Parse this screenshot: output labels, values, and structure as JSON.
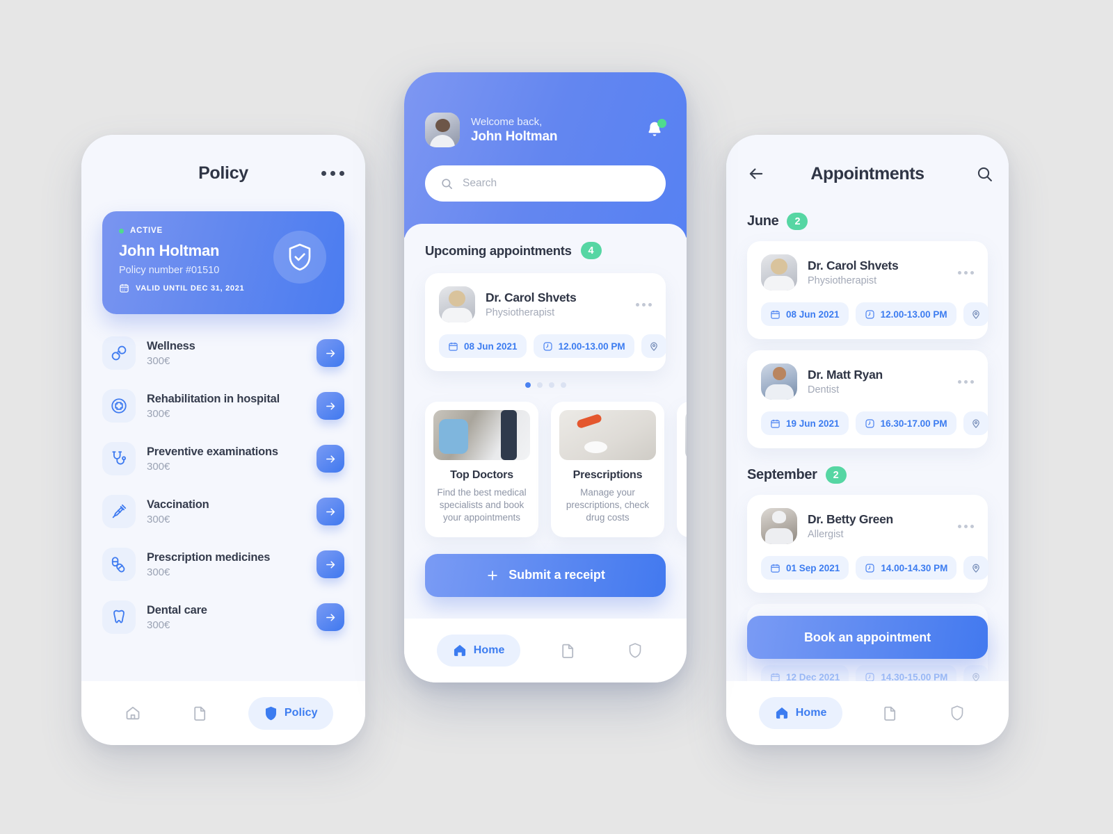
{
  "policy_screen": {
    "title": "Policy",
    "more_icon": "more-horizontal-icon",
    "card": {
      "status": "ACTIVE",
      "name": "John Holtman",
      "policy_number": "Policy number #01510",
      "valid_until": "VALID UNTIL DEC 31, 2021",
      "shield_icon": "shield-check-icon",
      "calendar_icon": "calendar-icon",
      "gradient_from": "#7a95f0",
      "gradient_to": "#4a7cf0",
      "status_dot_color": "#4fdc8e"
    },
    "benefits": [
      {
        "title": "Wellness",
        "price": "300€",
        "icon": "bandage-icon"
      },
      {
        "title": "Rehabilitation in hospital",
        "price": "300€",
        "icon": "hospital-cross-icon"
      },
      {
        "title": "Preventive examinations",
        "price": "300€",
        "icon": "stethoscope-icon"
      },
      {
        "title": "Vaccination",
        "price": "300€",
        "icon": "syringe-icon"
      },
      {
        "title": "Prescription medicines",
        "price": "300€",
        "icon": "pills-icon"
      },
      {
        "title": "Dental care",
        "price": "300€",
        "icon": "tooth-icon"
      }
    ],
    "nav": [
      {
        "label": "",
        "icon": "home-icon",
        "active": false
      },
      {
        "label": "",
        "icon": "document-icon",
        "active": false
      },
      {
        "label": "Policy",
        "icon": "shield-icon",
        "active": true
      }
    ]
  },
  "home_screen": {
    "greeting": "Welcome back,",
    "user_name": "John Holtman",
    "avatar_icon": "user-avatar",
    "bell_icon": "bell-icon",
    "bell_has_notification": true,
    "search": {
      "placeholder": "Search",
      "icon": "search-icon"
    },
    "section_title": "Upcoming appointments",
    "section_count": "4",
    "appointment": {
      "doctor": "Dr. Carol Shvets",
      "specialty": "Physiotherapist",
      "date": "08 Jun 2021",
      "time": "12.00-13.00 PM",
      "calendar_icon": "calendar-icon",
      "clock_icon": "clock-icon",
      "pin_icon": "map-pin-icon",
      "more_icon": "more-horizontal-icon"
    },
    "carousel_total": 4,
    "carousel_active": 0,
    "categories": [
      {
        "title": "Top Doctors",
        "description": "Find the best medical specialists and book your appointments",
        "image": "doctor-photo"
      },
      {
        "title": "Prescriptions",
        "description": "Manage your prescriptions, check drug costs",
        "image": "pills-photo"
      },
      {
        "title": "",
        "description": "",
        "image": "clipped-photo"
      }
    ],
    "submit_button": {
      "label": "Submit a receipt",
      "icon": "plus-icon"
    },
    "nav": [
      {
        "label": "Home",
        "icon": "home-icon",
        "active": true
      },
      {
        "label": "",
        "icon": "document-icon",
        "active": false
      },
      {
        "label": "",
        "icon": "shield-icon",
        "active": false
      }
    ]
  },
  "appointments_screen": {
    "title": "Appointments",
    "back_icon": "arrow-left-icon",
    "search_icon": "search-icon",
    "months": [
      {
        "name": "June",
        "count": "2",
        "appointments": [
          {
            "doctor": "Dr. Carol Shvets",
            "specialty": "Physiotherapist",
            "date": "08 Jun 2021",
            "time": "12.00-13.00 PM",
            "avatar": "carol-photo"
          },
          {
            "doctor": "Dr. Matt Ryan",
            "specialty": "Dentist",
            "date": "19 Jun 2021",
            "time": "16.30-17.00 PM",
            "avatar": "matt-photo"
          }
        ]
      },
      {
        "name": "September",
        "count": "2",
        "appointments": [
          {
            "doctor": "Dr. Betty Green",
            "specialty": "Allergist",
            "date": "01 Sep 2021",
            "time": "14.00-14.30 PM",
            "avatar": "betty-photo"
          }
        ]
      }
    ],
    "partial_card": {
      "date": "12 Dec 2021",
      "time": "14.30-15.00 PM"
    },
    "book_button": {
      "label": "Book an appointment"
    },
    "nav": [
      {
        "label": "Home",
        "icon": "home-icon",
        "active": true
      },
      {
        "label": "",
        "icon": "document-icon",
        "active": false
      },
      {
        "label": "",
        "icon": "shield-icon",
        "active": false
      }
    ]
  },
  "theme": {
    "background": "#e6e6e6",
    "screen_bg": "#f5f7fd",
    "accent_blue": "#4a7cf0",
    "accent_green": "#56d6a3",
    "text_dark": "#2f3545",
    "text_muted": "#a3a9b7"
  }
}
